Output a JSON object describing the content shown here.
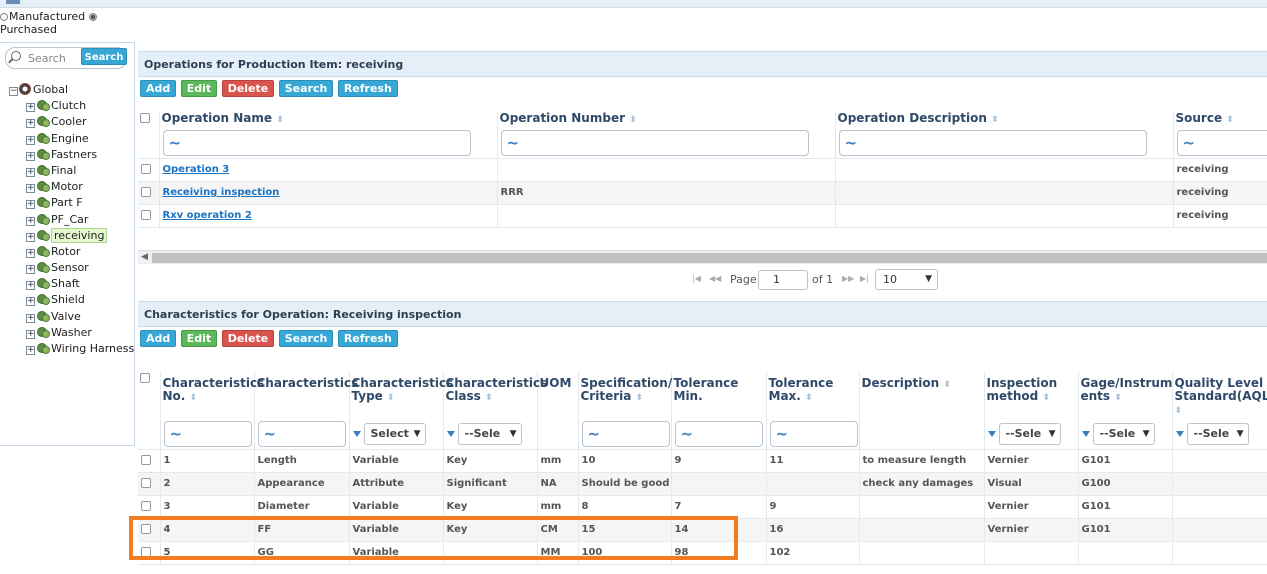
{
  "radios": {
    "manufactured_label": "Manufactured",
    "purchased_label": "Purchased"
  },
  "left_search": {
    "placeholder": "Search",
    "button_label": "Search"
  },
  "tree": {
    "root": "Global",
    "items": [
      "Clutch",
      "Cooler",
      "Engine",
      "Fastners",
      "Final",
      "Motor",
      "Part F",
      "PF_Car",
      "receiving",
      "Rotor",
      "Sensor",
      "Shaft",
      "Shield",
      "Valve",
      "Washer",
      "Wiring Harness"
    ],
    "selected": "receiving"
  },
  "toolbar_labels": {
    "add": "Add",
    "edit": "Edit",
    "delete": "Delete",
    "search": "Search",
    "refresh": "Refresh"
  },
  "operations": {
    "title": "Operations for Production Item: receiving",
    "columns": [
      "Operation Name",
      "Operation Number",
      "Operation Description",
      "Source"
    ],
    "filter_symbol": "~",
    "rows": [
      {
        "name": "Operation 3",
        "number": "",
        "description": "",
        "source": "receiving"
      },
      {
        "name": "Receiving inspection",
        "number": "RRR",
        "description": "",
        "source": "receiving"
      },
      {
        "name": "Rxv operation 2",
        "number": "",
        "description": "",
        "source": "receiving"
      }
    ],
    "pager": {
      "page_label": "Page",
      "page": "1",
      "of_label": "of 1",
      "page_size": "10"
    }
  },
  "characteristics": {
    "title": "Characteristics for Operation: Receiving inspection",
    "columns": {
      "no": [
        "Characteristics",
        "No."
      ],
      "name": [
        "Characteristics",
        ""
      ],
      "type": [
        "Characteristics",
        "Type"
      ],
      "class": [
        "Characteristics",
        "Class"
      ],
      "uom": [
        "UOM",
        ""
      ],
      "spec": [
        "Specification/",
        "Criteria"
      ],
      "tmin": [
        "Tolerance Min.",
        ""
      ],
      "tmax": [
        "Tolerance",
        "Max."
      ],
      "desc": [
        "Description",
        ""
      ],
      "method": [
        "Inspection",
        "method"
      ],
      "gage": [
        "Gage/Instrum",
        "ents"
      ],
      "aql": [
        "Quality Level",
        "Standard(AQL)"
      ]
    },
    "filters": {
      "type": "Select",
      "class": "--Sele",
      "method": "--Sele",
      "gage": "--Sele",
      "aql": "--Sele"
    },
    "rows": [
      {
        "no": "1",
        "name": "Length",
        "type": "Variable",
        "class": "Key",
        "uom": "mm",
        "spec": "10",
        "tmin": "9",
        "tmax": "11",
        "desc": "to measure length",
        "method": "Vernier",
        "gage": "G101",
        "aql": ""
      },
      {
        "no": "2",
        "name": "Appearance",
        "type": "Attribute",
        "class": "Significant",
        "uom": "NA",
        "spec": "Should be good",
        "tmin": "",
        "tmax": "",
        "desc": "check any damages",
        "method": "Visual",
        "gage": "G100",
        "aql": ""
      },
      {
        "no": "3",
        "name": "Diameter",
        "type": "Variable",
        "class": "Key",
        "uom": "mm",
        "spec": "8",
        "tmin": "7",
        "tmax": "9",
        "desc": "",
        "method": "Vernier",
        "gage": "G101",
        "aql": ""
      },
      {
        "no": "4",
        "name": "FF",
        "type": "Variable",
        "class": "Key",
        "uom": "CM",
        "spec": "15",
        "tmin": "14",
        "tmax": "16",
        "desc": "",
        "method": "Vernier",
        "gage": "G101",
        "aql": ""
      },
      {
        "no": "5",
        "name": "GG",
        "type": "Variable",
        "class": "",
        "uom": "MM",
        "spec": "100",
        "tmin": "98",
        "tmax": "102",
        "desc": "",
        "method": "",
        "gage": "",
        "aql": ""
      }
    ]
  },
  "colors": {
    "highlight": "#f47c20",
    "add": "#37a7d6",
    "edit": "#5cb85c",
    "delete": "#d9534f"
  }
}
